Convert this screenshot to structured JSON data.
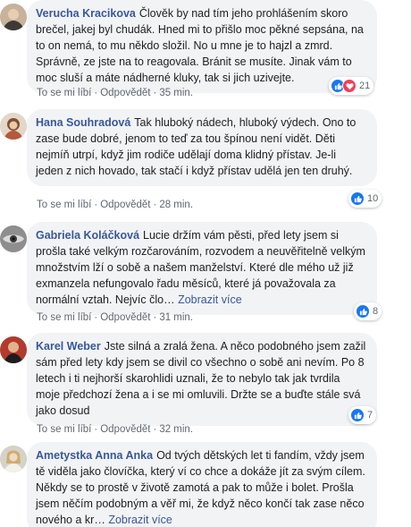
{
  "comments": [
    {
      "author": "Verucha Kracikova",
      "text": "Člověk by nad tím jeho prohlášením skoro brečel, jakej byl chudák. Hned mi to přišlo moc pěkné sepsána, na to on nemá, to mu někdo složil. No u mne je to hajzl a zmrd. Správně, ze jste na to reagovala. Bránit se musíte. Jinak vám to moc sluší a máte nádherné kluky, tak si jich uzivejte.",
      "more": "",
      "like": "To se mi líbí",
      "reply": "Odpovědět",
      "time": "35 min.",
      "reaction_count": "21",
      "reactions": [
        "like-icon",
        "love-icon"
      ]
    },
    {
      "author": "Hana Souhradová",
      "text": "Tak hluboký nádech, hluboký výdech. Ono to zase bude dobré, jenom to teď za tou špínou není vidět. Děti nejmíň utrpí, když jim rodiče udělají doma klidný přístav. Je-li jeden z nich hovado, tak stačí i když přístav udělá jen ten druhý.",
      "more": "",
      "like": "To se mi líbí",
      "reply": "Odpovědět",
      "time": "28 min.",
      "reaction_count": "10",
      "reactions": [
        "like-icon"
      ]
    },
    {
      "author": "Gabriela Koláčková",
      "text": "Lucie držím vám pěsti, před lety jsem si prošla také velkým rozčarováním, rozvodem a neuvěřitelně velkým množstvím lží o sobě a našem manželství. Které dle mého už již exmanzela nefungovalo řadu měsíců, které já považovala za normální vztah. Nejvíc člo…",
      "more": "Zobrazit více",
      "like": "To se mi líbí",
      "reply": "Odpovědět",
      "time": "31 min.",
      "reaction_count": "8",
      "reactions": [
        "like-icon"
      ]
    },
    {
      "author": "Karel Weber",
      "text": "Jste silná a zralá žena. A něco podobného jsem zažil sám před lety kdy jsem se divil co všechno o sobě ani nevím. Po 8 letech i ti nejhorší skarohlidi uznali, že to nebylo tak jak tvrdila moje předchozí žena a i se mi omluvili. Držte se a buďte stále svá jako dosud",
      "more": "",
      "like": "To se mi líbí",
      "reply": "Odpovědět",
      "time": "32 min.",
      "reaction_count": "7",
      "reactions": [
        "like-icon"
      ]
    },
    {
      "author": "Ametystka Anna Anka",
      "text": "Od tvých dětských let ti fandím, vždy jsem tě viděla jako človíčka, který ví co chce a dokáže jít za svým cílem. Někdy se to prostě v životě zamotá a pak to může i bolet. Prošla jsem něčím podobným a věř mi, že když něco končí tak zase něco nového a kr…",
      "more": "Zobrazit více",
      "like": "",
      "reply": "",
      "time": "",
      "reaction_count": "",
      "reactions": []
    }
  ],
  "colors": {
    "author": "#385898",
    "bubble": "#f2f3f5",
    "like": "#1877f2",
    "love": "#f33e58"
  }
}
